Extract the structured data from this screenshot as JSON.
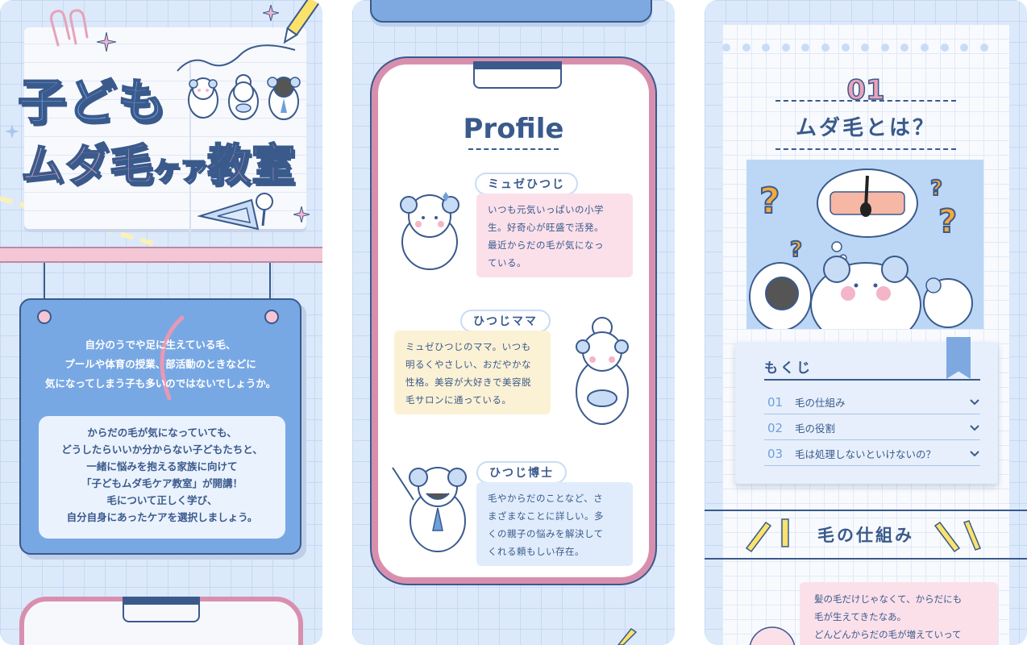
{
  "panel1": {
    "title_line1": "子ども",
    "title_line2_a": "ムダ毛",
    "title_line2_small": "ケア",
    "title_line2_b": "教室",
    "intro_lines": [
      "自分のうでや足に生えている毛、",
      "プールや体育の授業、部活動のときなどに",
      "気になってしまう子も多いのではないでしょうか。"
    ],
    "message_lines": [
      "からだの毛が気になっていても、",
      "どうしたらいいか分からない子どもたちと、",
      "一緒に悩みを抱える家族に向けて",
      "「子どもムダ毛ケア教室」が開講！",
      "毛について正しく学び、",
      "自分自身にあったケアを選択しましょう。"
    ]
  },
  "panel2": {
    "profile_title": "Profile",
    "characters": [
      {
        "name": "ミュゼひつじ",
        "bio_lines": [
          "いつも元気いっぱいの小学",
          "生。好奇心が旺盛で活発。",
          "最近からだの毛が気になっ",
          "ている。"
        ]
      },
      {
        "name": "ひつじママ",
        "bio_lines": [
          "ミュゼひつじのママ。いつも",
          "明るくやさしい、おだやかな",
          "性格。美容が大好きで美容脱",
          "毛サロンに通っている。"
        ]
      },
      {
        "name": "ひつじ博士",
        "bio_lines": [
          "毛やからだのことなど、さ",
          "まざまなことに詳しい。多",
          "くの親子の悩みを解決して",
          "くれる頼もしい存在。"
        ]
      }
    ]
  },
  "panel3": {
    "section_number": "01",
    "section_title": "ムダ毛とは？",
    "toc": {
      "title": "もくじ",
      "items": [
        {
          "num": "01",
          "label": "毛の仕組み"
        },
        {
          "num": "02",
          "label": "毛の役割"
        },
        {
          "num": "03",
          "label": "毛は処理しないといけないの？"
        }
      ]
    },
    "subsection_title": "毛の仕組み",
    "speech_lines": [
      "髪の毛だけじゃなくて、からだにも",
      "毛が生えてきたなあ。",
      "どんどんからだの毛が増えていって"
    ]
  },
  "colors": {
    "navy": "#3a5a8c",
    "sky": "#78a8e4",
    "pink": "#d88fae",
    "background": "#dbe9fb"
  }
}
